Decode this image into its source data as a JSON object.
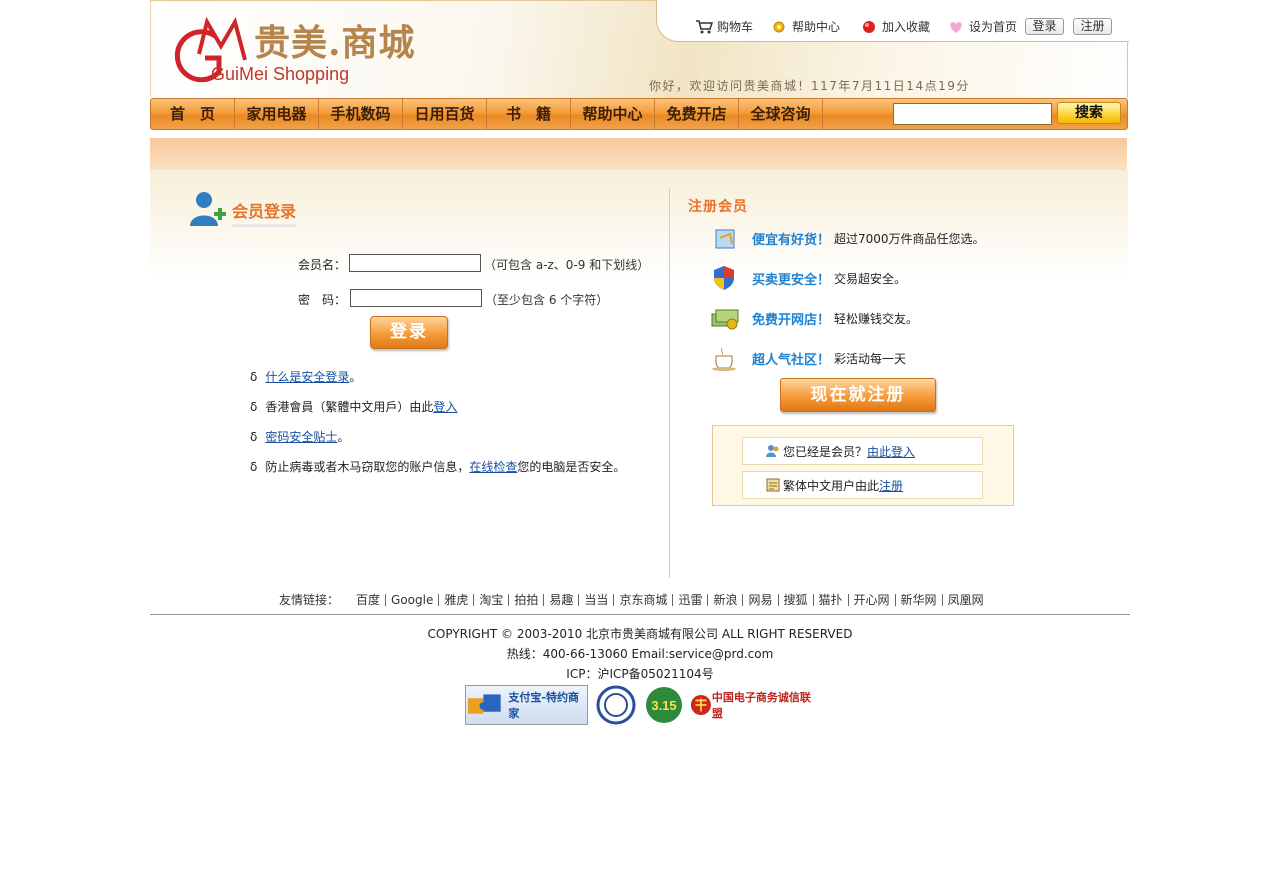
{
  "brand": {
    "name_cn": "贵美.商城",
    "name_en": "GuiMei Shopping",
    "logo_mark": "GM"
  },
  "toplinks": {
    "cart": "购物车",
    "help": "帮助中心",
    "favorite": "加入收藏",
    "homepage": "设为首页",
    "login": "登录",
    "register": "注册"
  },
  "welcome": "你好，欢迎访问贵美商城！117年7月11日14点19分",
  "nav": {
    "items": [
      "首　页",
      "家用电器",
      "手机数码",
      "日用百货",
      "书　籍",
      "帮助中心",
      "免费开店",
      "全球咨询"
    ],
    "search_placeholder": "",
    "search_label": "搜索"
  },
  "login": {
    "title": "会员登录",
    "username_label": "会员名：",
    "username_value": "",
    "username_hint": "（可包含 a-z、0-9 和下划线）",
    "password_label": "密　码：",
    "password_value": "",
    "password_hint": "（至少包含 6 个字符）",
    "button": "登录",
    "tips": [
      {
        "bullet": "δ",
        "link": "什么是安全登录",
        "after": "。",
        "before": ""
      },
      {
        "bullet": "δ",
        "before": "香港會員（繁體中文用戶）由此",
        "link": "登入",
        "after": ""
      },
      {
        "bullet": "δ",
        "link": "密码安全贴士",
        "after": "。",
        "before": ""
      },
      {
        "bullet": "δ",
        "before": "防止病毒或者木马窃取您的账户信息，",
        "link": "在线检查",
        "after": "您的电脑是否安全。"
      }
    ]
  },
  "register": {
    "title": "注册会员",
    "features": [
      {
        "head": "便宜有好货！",
        "text": "超过7000万件商品任您选。",
        "icon": "shopping-icon"
      },
      {
        "head": "买卖更安全！",
        "text": "交易超安全。",
        "icon": "shield-icon"
      },
      {
        "head": "免费开网店！",
        "text": "轻松赚钱交友。",
        "icon": "money-icon"
      },
      {
        "head": "超人气社区！",
        "text": "彩活动每一天",
        "icon": "coffee-icon"
      }
    ],
    "button": "现在就注册",
    "member_text": "您已经是会员？",
    "member_link": "由此登入",
    "trad_text": "繁体中文用户由此",
    "trad_link": "注册"
  },
  "friends": {
    "label": "友情链接：",
    "links": [
      "百度",
      "Google",
      "雅虎",
      "淘宝",
      "拍拍",
      "易趣",
      "当当",
      "京东商城",
      "迅雷",
      "新浪",
      "网易",
      "搜狐",
      "猫扑",
      "开心网",
      "新华网",
      "凤凰网"
    ]
  },
  "footer": {
    "copyright": "COPYRIGHT © 2003-2010 北京市贵美商城有限公司 ALL RIGHT RESERVED",
    "hotline": "热线：400-66-13060 Email:service@prd.com",
    "icp": "ICP：沪ICP备05021104号",
    "badges": [
      "支付宝-特约商家",
      "中国电子商务诚信联盟"
    ],
    "badge_315": "3.15"
  },
  "colors": {
    "accent_orange": "#f59b3b",
    "title_orange": "#e8742a",
    "feature_blue": "#1e82d2",
    "link_blue": "#1a4fa0"
  }
}
